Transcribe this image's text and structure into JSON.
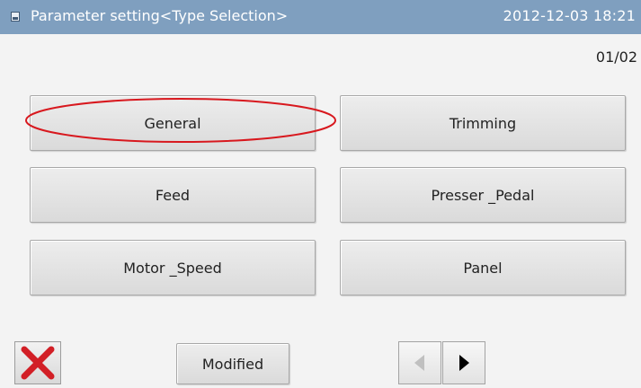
{
  "titlebar": {
    "title": "Parameter setting<Type Selection>",
    "datetime": "2012-12-03  18:21",
    "icon": "screen-icon"
  },
  "page_indicator": "01/02",
  "type_buttons": [
    {
      "label": "General",
      "highlighted": true
    },
    {
      "label": "Trimming"
    },
    {
      "label": "Feed"
    },
    {
      "label": "Presser _Pedal"
    },
    {
      "label": "Motor _Speed"
    },
    {
      "label": "Panel"
    }
  ],
  "footer": {
    "close_icon": "red-x-close-icon",
    "modified_label": "Modified",
    "prev_icon": "left-arrow-icon",
    "next_icon": "right-arrow-icon"
  },
  "colors": {
    "titlebar": "#7f9fbf",
    "highlight": "#d8181e",
    "close_x": "#d21f26",
    "arrow_disabled": "#c0c0c0",
    "arrow_enabled": "#000000"
  }
}
